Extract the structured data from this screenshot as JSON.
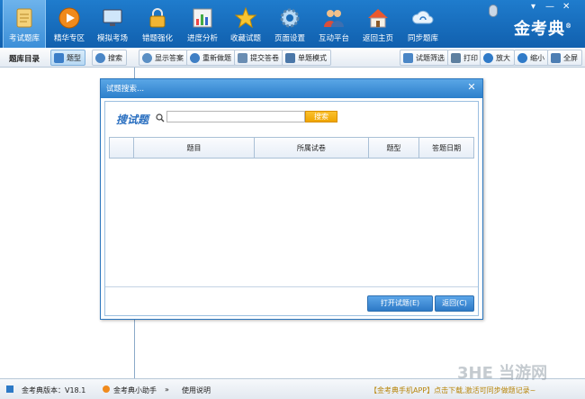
{
  "nav": {
    "items": [
      {
        "label": "考试题库",
        "icon": "question-bank-icon",
        "color": "#f4d27a"
      },
      {
        "label": "精华专区",
        "icon": "play-icon",
        "color": "#f08a1c"
      },
      {
        "label": "模拟考场",
        "icon": "monitor-icon",
        "color": "#cfe6fa"
      },
      {
        "label": "错题强化",
        "icon": "lock-icon",
        "color": "#f2b533"
      },
      {
        "label": "进度分析",
        "icon": "bar-chart-icon",
        "color": "#f3f3f3"
      },
      {
        "label": "收藏试题",
        "icon": "star-icon",
        "color": "#f7c531"
      },
      {
        "label": "页面设置",
        "icon": "gear-icon",
        "color": "#b8d9f4"
      },
      {
        "label": "互动平台",
        "icon": "users-icon",
        "color": "#f1c089"
      },
      {
        "label": "返回主页",
        "icon": "home-icon",
        "color": "#e9582e"
      },
      {
        "label": "同步题库",
        "icon": "cloud-sync-icon",
        "color": "#e8f3fc"
      }
    ],
    "logo": "金考典",
    "logo_mark": "®",
    "win_controls": [
      "▾",
      "—",
      "✕"
    ]
  },
  "toolbar": {
    "title": "题库目录",
    "buttons": [
      {
        "label": "题型",
        "icon": "book-icon",
        "color": "#3b7ec8"
      },
      {
        "label": "搜索",
        "icon": "magnifier-icon",
        "color": "#4a86c6"
      },
      {
        "label": "显示答案",
        "icon": "eye-icon",
        "color": "#5a8fc4"
      },
      {
        "label": "重新做题",
        "icon": "refresh-icon",
        "color": "#3f7fc4"
      },
      {
        "label": "提交答卷",
        "icon": "document-icon",
        "color": "#6a8db2"
      },
      {
        "label": "单题模式",
        "icon": "single-icon",
        "color": "#4a77a8"
      },
      {
        "label": "试题筛选",
        "icon": "filter-icon",
        "color": "#4a86c6"
      },
      {
        "label": "打印",
        "icon": "printer-icon",
        "color": "#5d7f9f"
      },
      {
        "label": "放大",
        "icon": "zoom-in-icon",
        "color": "#2f7ac8"
      },
      {
        "label": "缩小",
        "icon": "zoom-out-icon",
        "color": "#2f7ac8"
      },
      {
        "label": "全屏",
        "icon": "fullscreen-icon",
        "color": "#4d7eb3"
      }
    ]
  },
  "dialog": {
    "title": "试题搜索...",
    "close": "✕",
    "search_label": "搜试题",
    "search_value": "",
    "search_button": "搜索",
    "columns": [
      "",
      "题目",
      "所属试卷",
      "题型",
      "答题日期"
    ],
    "open_button": "打开试题(E)",
    "back_button": "返回(C)"
  },
  "status": {
    "version": "金考典版本：V18.1",
    "helper": "金考典小助手",
    "arrows": "»",
    "manual": "使用说明",
    "promo": "【金考典手机APP】点击下载,激活可同步做题记录~"
  },
  "watermark": "3HE 当游网"
}
